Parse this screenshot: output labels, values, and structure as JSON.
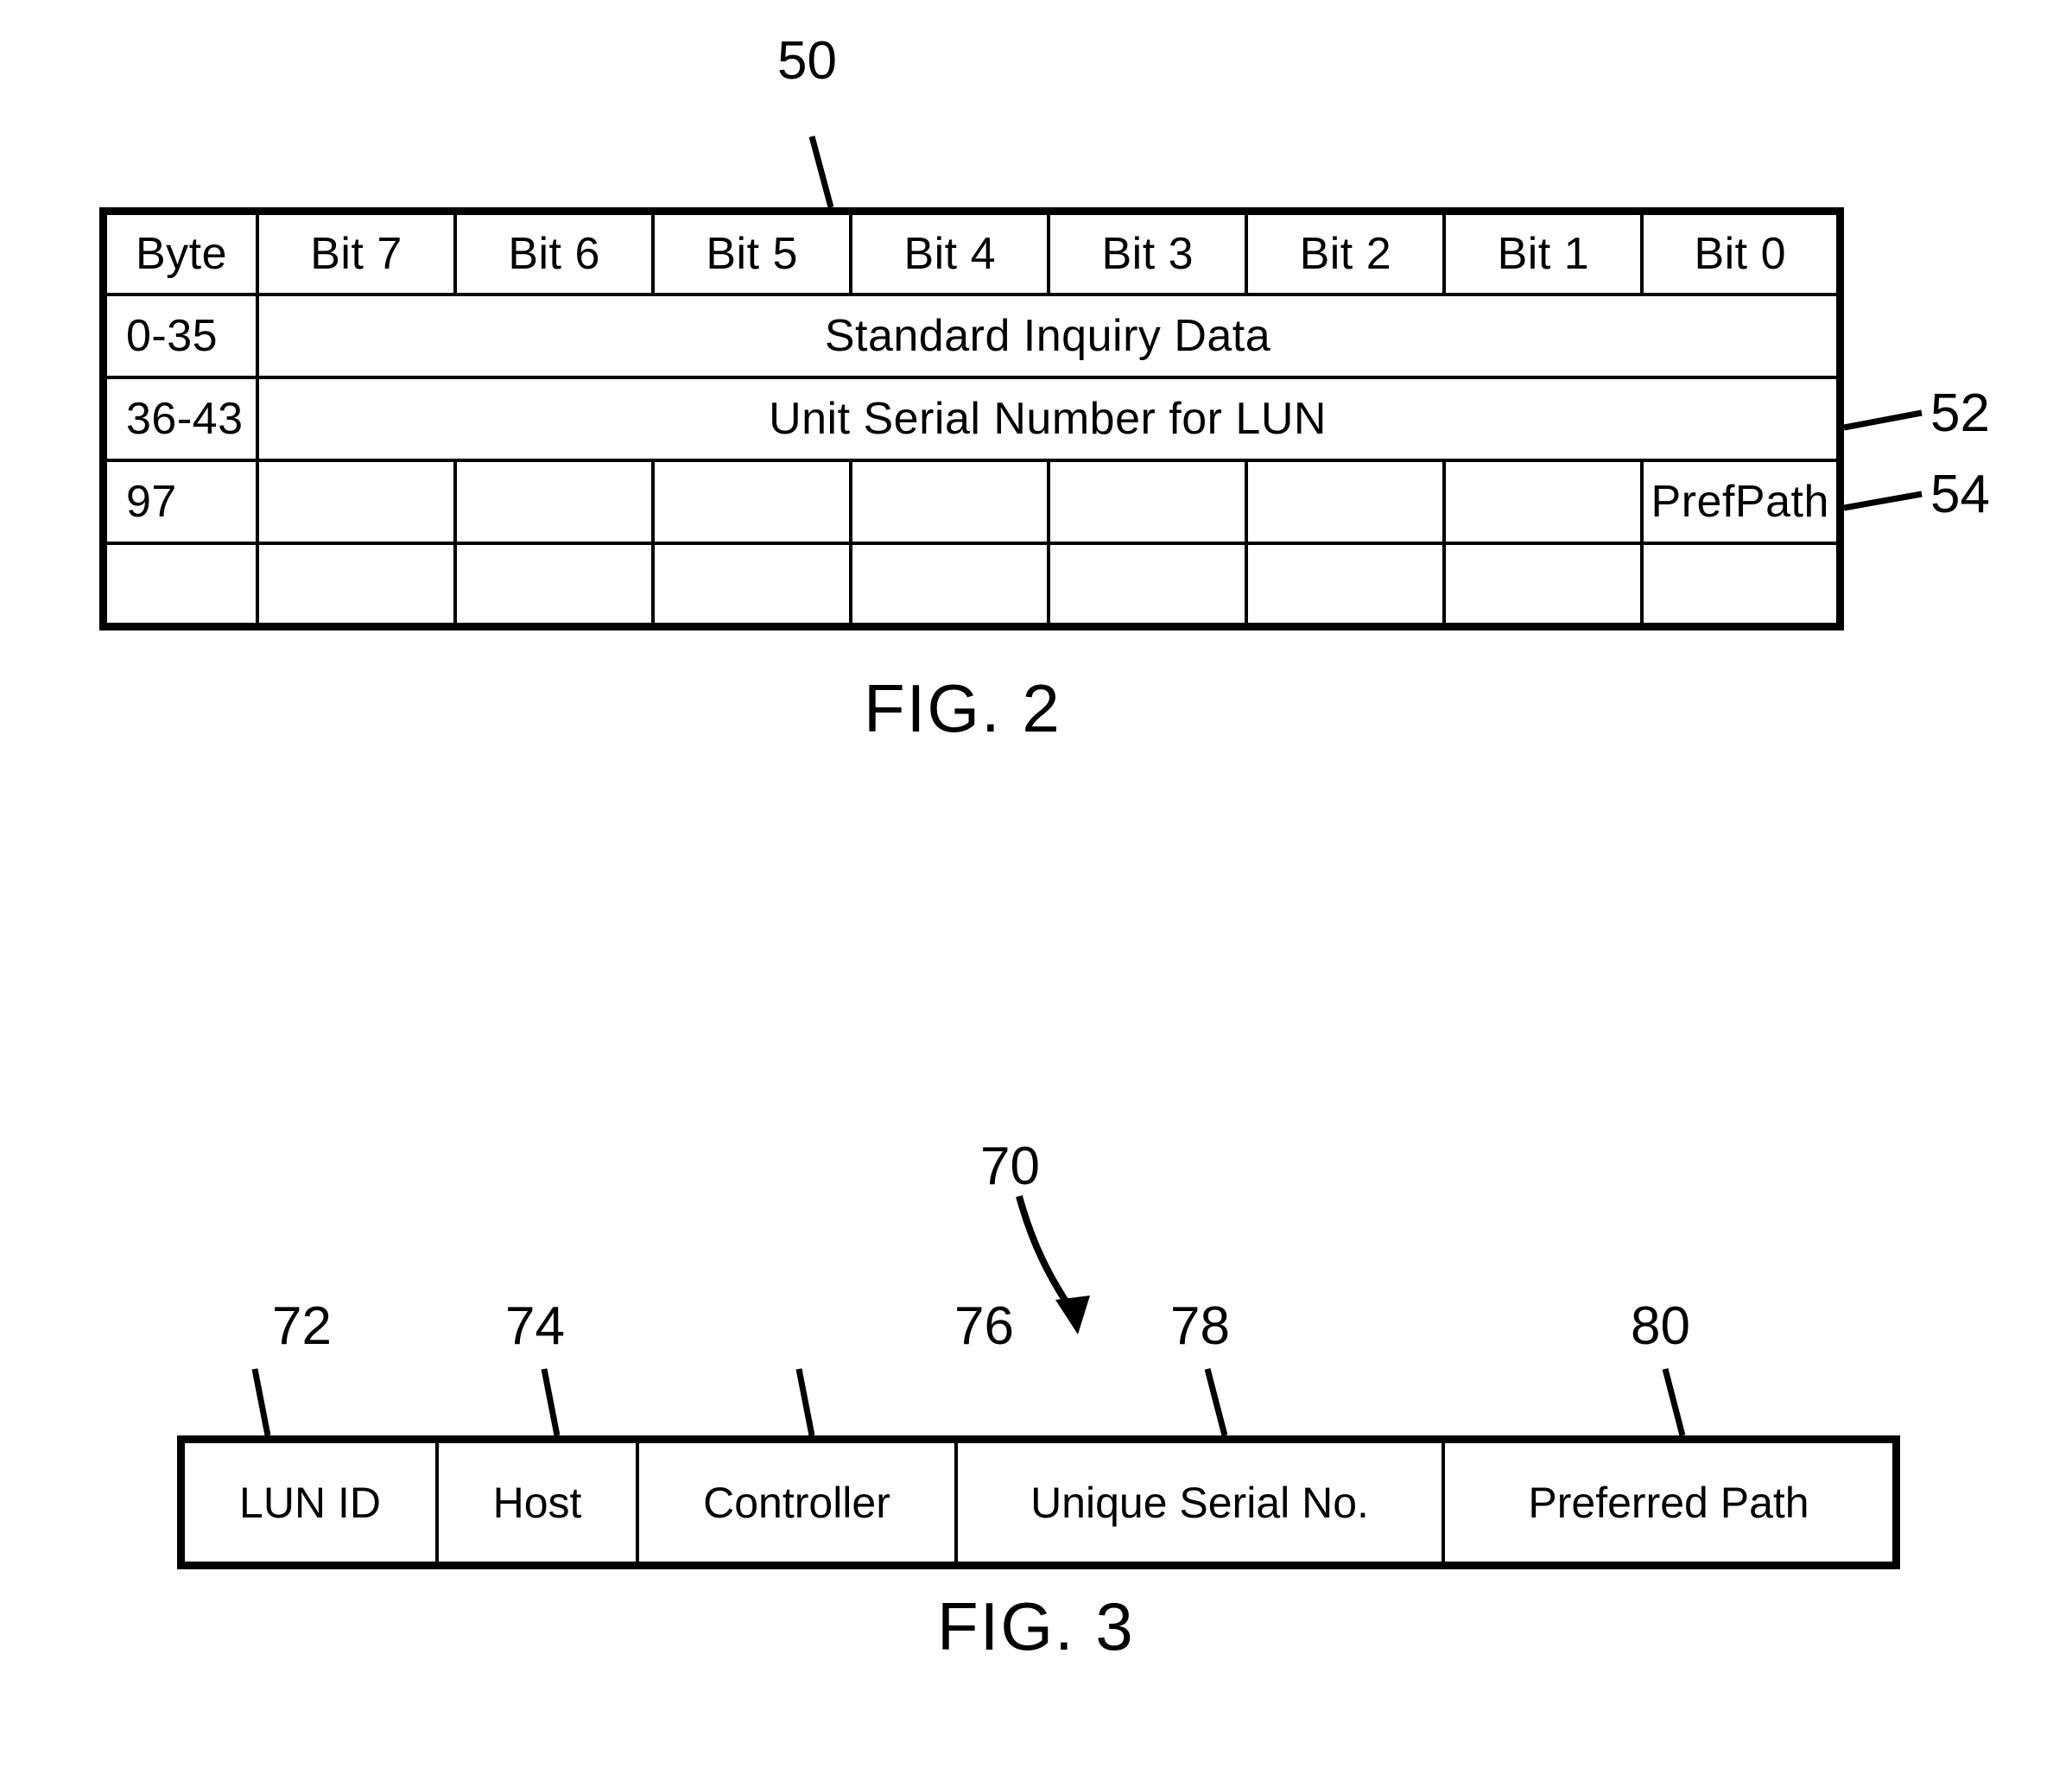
{
  "figure2": {
    "caption": "FIG. 2",
    "ref_table": "50",
    "ref_serial_row": "52",
    "ref_prefpath": "54",
    "columns": [
      "Byte",
      "Bit 7",
      "Bit 6",
      "Bit 5",
      "Bit 4",
      "Bit 3",
      "Bit 2",
      "Bit 1",
      "Bit 0"
    ],
    "rows": [
      {
        "byte": "0-35",
        "span_text": "Standard Inquiry Data",
        "type": "span"
      },
      {
        "byte": "36-43",
        "span_text": "Unit Serial Number for LUN",
        "type": "span"
      },
      {
        "byte": "97",
        "type": "bits",
        "bits": [
          "",
          "",
          "",
          "",
          "",
          "",
          "",
          "PrefPath"
        ]
      },
      {
        "byte": "",
        "type": "bits",
        "bits": [
          "",
          "",
          "",
          "",
          "",
          "",
          "",
          ""
        ]
      }
    ]
  },
  "figure3": {
    "caption": "FIG. 3",
    "ref_record": "70",
    "fields": [
      {
        "label": "LUN ID",
        "ref": "72"
      },
      {
        "label": "Host",
        "ref": "74"
      },
      {
        "label": "Controller",
        "ref": "76"
      },
      {
        "label": "Unique Serial No.",
        "ref": "78"
      },
      {
        "label": "Preferred Path",
        "ref": "80"
      }
    ]
  }
}
